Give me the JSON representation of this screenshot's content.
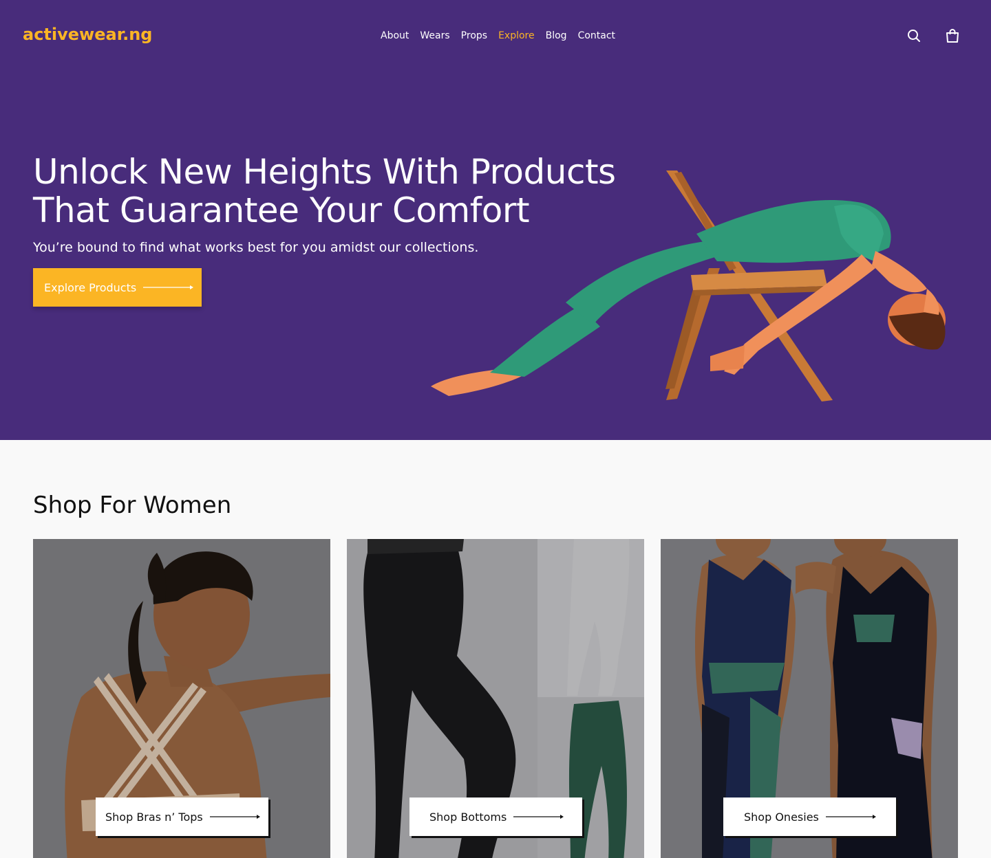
{
  "brand": {
    "logo": "activewear.ng",
    "accent": "#fbb524",
    "hero_bg": "#482c7b"
  },
  "nav": {
    "items": [
      {
        "label": "About"
      },
      {
        "label": "Wears"
      },
      {
        "label": "Props"
      },
      {
        "label": "Explore",
        "active": true
      },
      {
        "label": "Blog"
      },
      {
        "label": "Contact"
      }
    ]
  },
  "header_icons": {
    "search": "search-icon",
    "cart": "shopping-bag-icon"
  },
  "hero": {
    "headline": "Unlock New Heights With Products That Guarantee Your Comfort",
    "subline": "You’re bound to find what works best for you amidst our collections.",
    "cta_label": "Explore Products"
  },
  "section": {
    "title": "Shop For Women",
    "cards": [
      {
        "label": "Shop Bras n’ Tops"
      },
      {
        "label": "Shop Bottoms"
      },
      {
        "label": "Shop Onesies"
      }
    ]
  }
}
